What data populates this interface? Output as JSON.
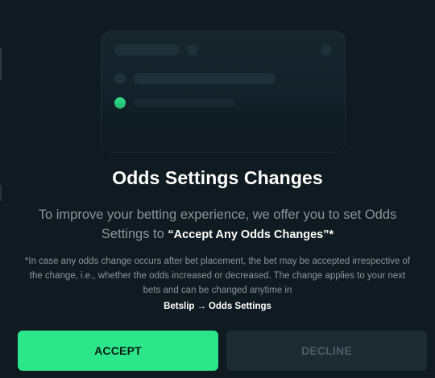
{
  "modal": {
    "title": "Odds Settings Changes",
    "lead_text": "To improve your betting experience, we offer you to set Odds Settings to ",
    "lead_highlight": "“Accept Any Odds Changes”*",
    "note": "*In case any odds change occurs after bet placement, the bet may be accepted irrespective of the change, i.e., whether the odds increased or decreased. The change applies to your next bets and can be changed anytime in",
    "path_from": "Betslip",
    "path_arrow": "→",
    "path_to": "Odds Settings"
  },
  "buttons": {
    "accept_label": "ACCEPT",
    "decline_label": "DECLINE"
  },
  "colors": {
    "background": "#0f1a21",
    "accent": "#2ce68a",
    "decline_bg": "#1c2a32",
    "muted_text": "#8a969c"
  },
  "icons": {
    "illustration": "odds-slip-illustration",
    "status_dot": "green-dot-icon"
  }
}
